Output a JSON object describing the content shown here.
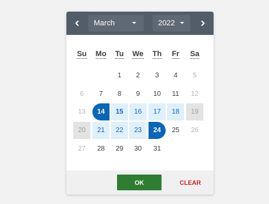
{
  "header": {
    "prev_icon": "chevron-left-icon",
    "next_icon": "chevron-right-icon",
    "month": "March",
    "year": "2022"
  },
  "weekdays": [
    "Su",
    "Mo",
    "Tu",
    "We",
    "Th",
    "Fr",
    "Sa"
  ],
  "weeks": [
    [
      "",
      "",
      "1",
      "2",
      "3",
      "4",
      "5"
    ],
    [
      "6",
      "7",
      "8",
      "9",
      "10",
      "11",
      "12"
    ],
    [
      "13",
      "14",
      "15",
      "16",
      "17",
      "18",
      "19"
    ],
    [
      "20",
      "21",
      "22",
      "23",
      "24",
      "25",
      "26"
    ],
    [
      "27",
      "28",
      "29",
      "30",
      "31",
      "",
      ""
    ]
  ],
  "selection": {
    "start": "14",
    "end": "24",
    "today": "15"
  },
  "footer": {
    "ok_label": "OK",
    "clear_label": "CLEAR"
  },
  "colors": {
    "header": "#535c69",
    "selected": "#0b66b4",
    "range": "#dff0fb",
    "ok": "#2e7d32",
    "clear": "#c62828"
  }
}
